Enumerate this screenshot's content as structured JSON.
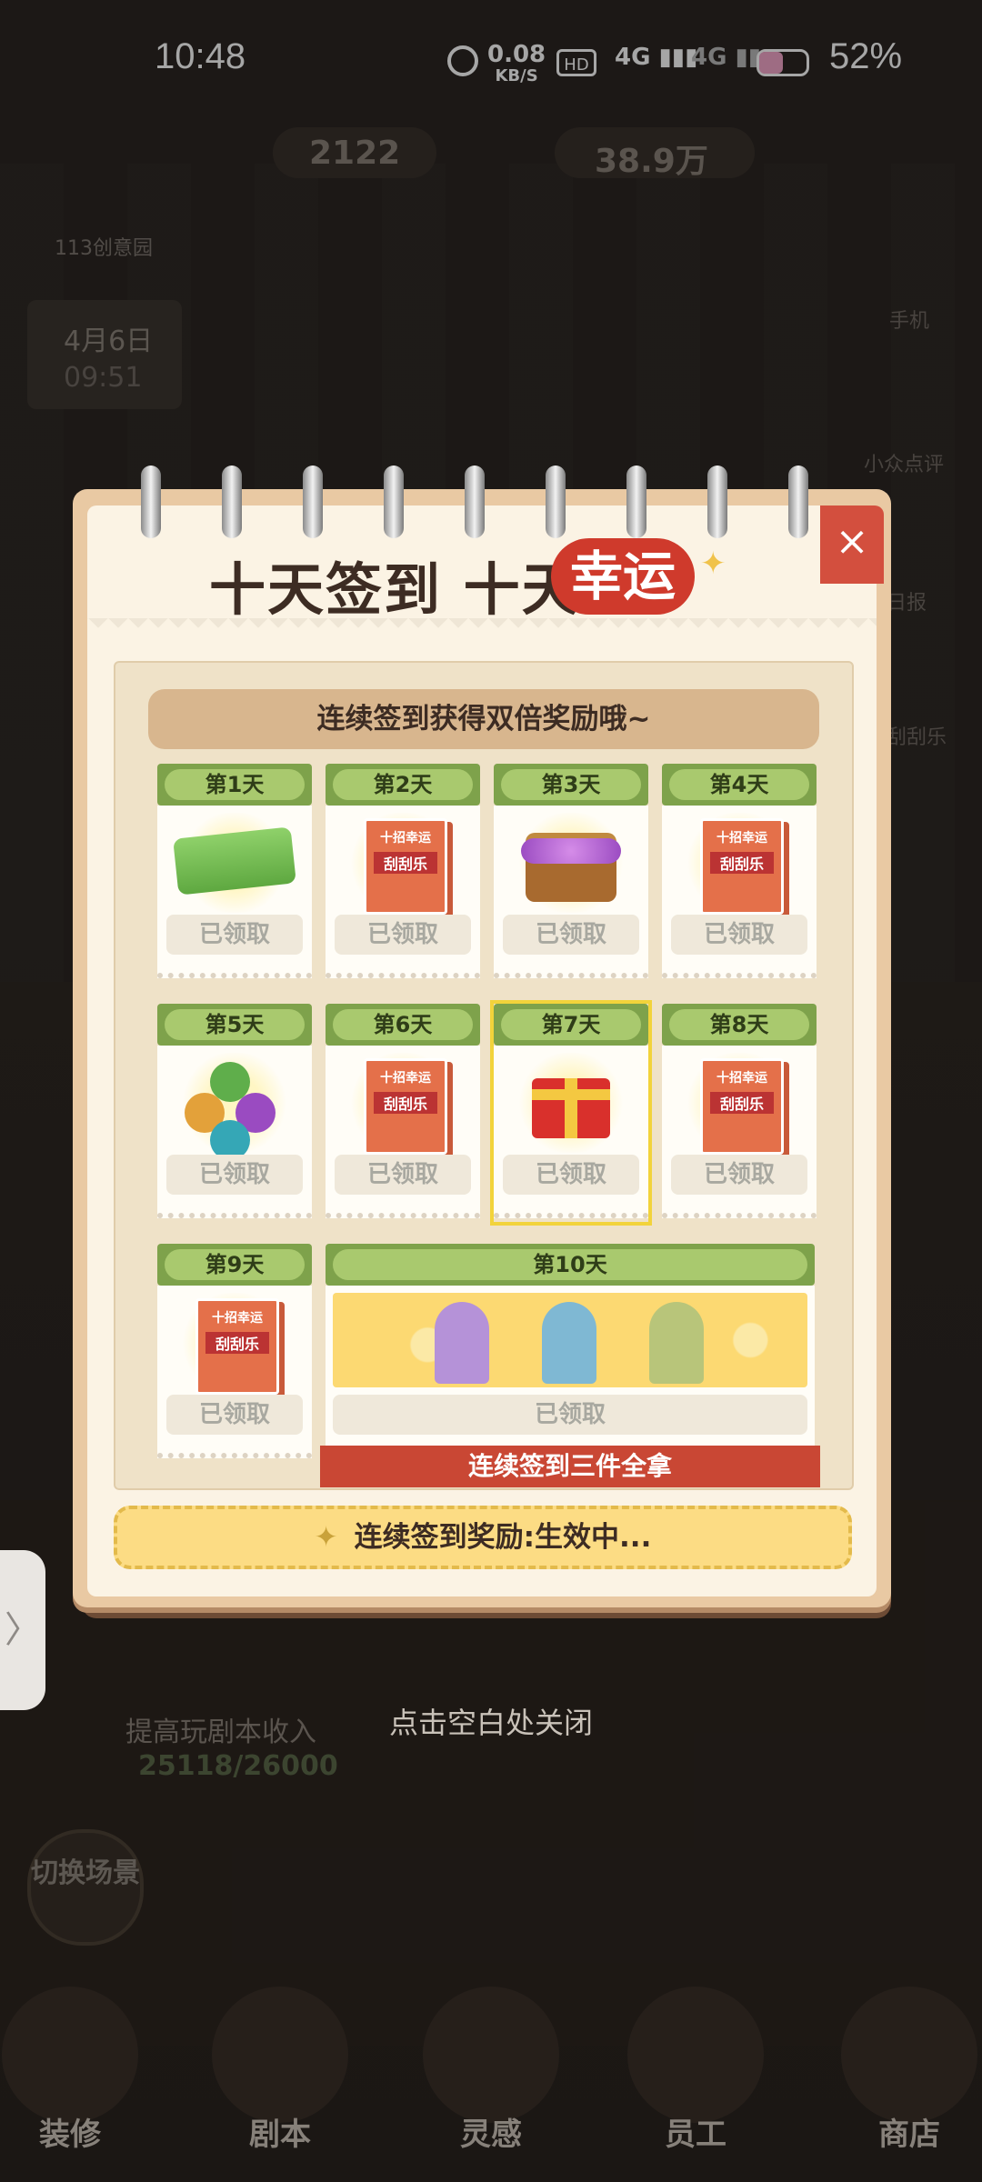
{
  "status_bar": {
    "time": "10:48",
    "net_speed": "0.08",
    "net_unit": "KB/S",
    "battery": "52%"
  },
  "hud": {
    "gems": "2122",
    "money": "38.9万",
    "creative": "113创意园",
    "date": "4月6日",
    "clock": "09:51"
  },
  "side_right": [
    "手机",
    "小众点评",
    "日报",
    "刮刮乐"
  ],
  "modal": {
    "title_left": "十天签到 十天",
    "title_highlight": "幸运",
    "close": "×",
    "banner": "连续签到获得双倍奖励哦~",
    "days": [
      {
        "label": "第1天",
        "status": "已领取",
        "icon": "money-stack-icon"
      },
      {
        "label": "第2天",
        "status": "已领取",
        "icon": "lottery-ticket-icon"
      },
      {
        "label": "第3天",
        "status": "已领取",
        "icon": "treasure-chest-icon"
      },
      {
        "label": "第4天",
        "status": "已领取",
        "icon": "lottery-ticket-icon"
      },
      {
        "label": "第5天",
        "status": "已领取",
        "icon": "orbs-icon"
      },
      {
        "label": "第6天",
        "status": "已领取",
        "icon": "lottery-ticket-icon"
      },
      {
        "label": "第7天",
        "status": "已领取",
        "icon": "gift-box-icon",
        "highlighted": true
      },
      {
        "label": "第8天",
        "status": "已领取",
        "icon": "lottery-ticket-icon"
      },
      {
        "label": "第9天",
        "status": "已领取",
        "icon": "lottery-ticket-icon"
      }
    ],
    "day10": {
      "label": "第10天",
      "status": "已领取",
      "ribbon": "连续签到三件全拿"
    },
    "ticket_text_top": "十招幸运",
    "ticket_text_mid": "刮刮乐",
    "bottom": "连续签到奖励:生效中..."
  },
  "hint": "点击空白处关闭",
  "background": {
    "task": "提高玩剧本收入",
    "progress": "25118/26000",
    "switch": "切换场景"
  },
  "nav": [
    "装修",
    "剧本",
    "灵感",
    "员工",
    "商店"
  ],
  "colors": {
    "accent_red": "#cf3a2c",
    "green_head": "#7ea24b",
    "yellow": "#fcdc84"
  }
}
